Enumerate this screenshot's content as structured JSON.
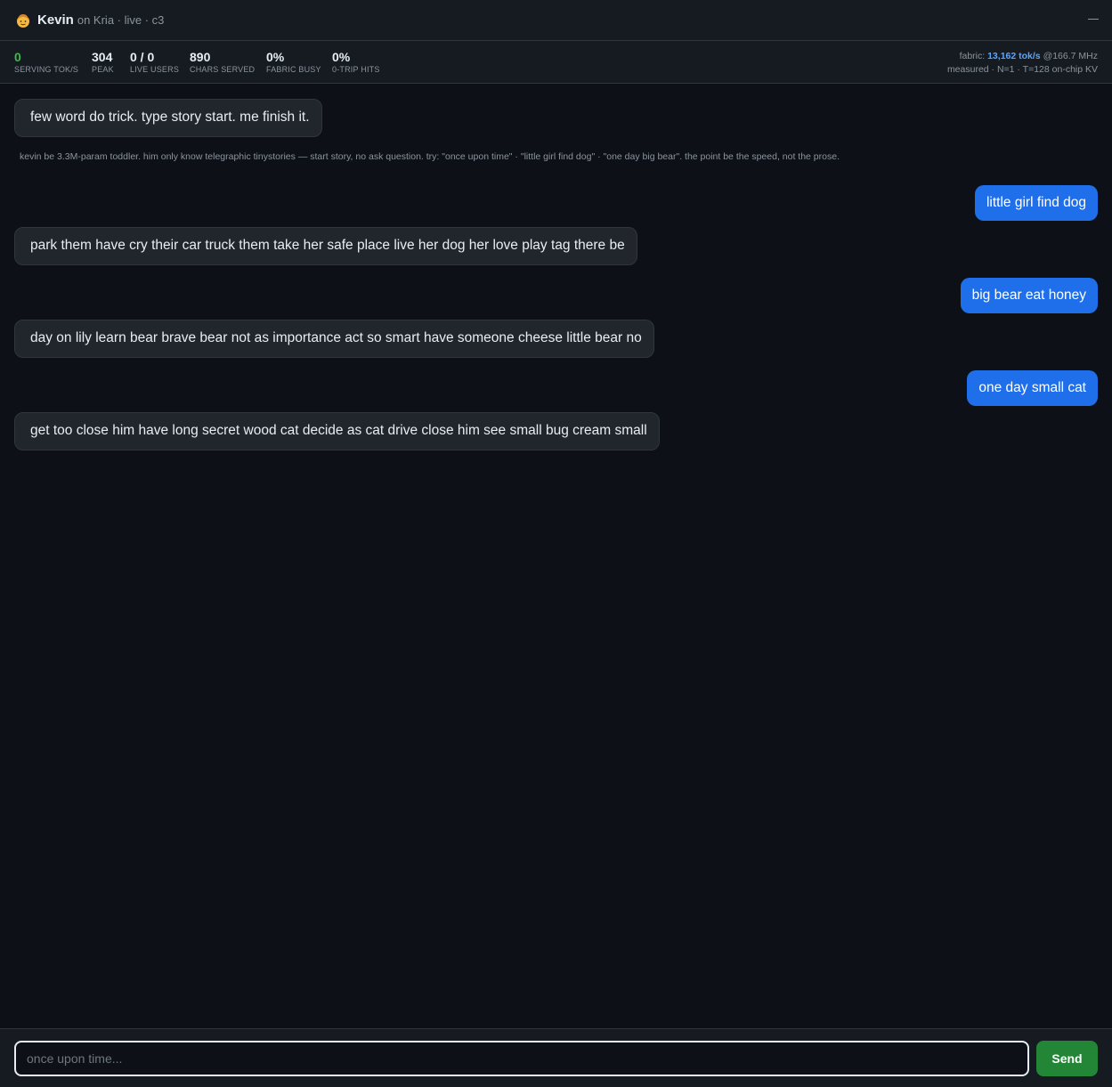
{
  "header": {
    "title": "Kevin",
    "subtitle": "on Kria · live · c3",
    "avatar_icon": "toddler-emoji-icon"
  },
  "stats": [
    {
      "value": "0",
      "label": "SERVING TOK/S",
      "color": "#3fb950"
    },
    {
      "value": "304",
      "label": "PEAK"
    },
    {
      "value": "0 / 0",
      "label": "LIVE USERS"
    },
    {
      "value": "890",
      "label": "CHARS SERVED"
    },
    {
      "value": "0%",
      "label": "FABRIC BUSY"
    },
    {
      "value": "0%",
      "label": "0-TRIP HITS"
    }
  ],
  "fabric": {
    "prefix": "fabric:",
    "rate": "13,162 tok/s",
    "freq": "@166.7 MHz",
    "note": "measured · N=1 · T=128 on-chip KV"
  },
  "chat": {
    "intro": "few word do trick. type story start. me finish it.",
    "hint": "kevin be 3.3M-param toddler. him only know telegraphic tinystories — start story, no ask question. try: \"once upon time\" · \"little girl find dog\" · \"one day big bear\". the point be the speed, not the prose.",
    "messages": [
      {
        "role": "user",
        "text": "little girl find dog"
      },
      {
        "role": "bot",
        "text": "park them have cry their car truck them take her safe place live her dog her love play tag there be"
      },
      {
        "role": "user",
        "text": "big bear eat honey"
      },
      {
        "role": "bot",
        "text": "day on lily learn bear brave bear not as importance act so smart have someone cheese little bear no"
      },
      {
        "role": "user",
        "text": "one day small cat"
      },
      {
        "role": "bot",
        "text": "get too close him have long secret wood cat decide as cat drive close him see small bug cream small"
      }
    ]
  },
  "composer": {
    "placeholder": "once upon time...",
    "value": "",
    "send_label": "Send"
  },
  "colors": {
    "background": "#0d1117",
    "panel": "#161b22",
    "user_bubble": "#1f6feb",
    "bot_bubble": "#21262d",
    "send_button": "#238636",
    "accent_blue": "#58a6ff",
    "accent_green": "#3fb950"
  }
}
